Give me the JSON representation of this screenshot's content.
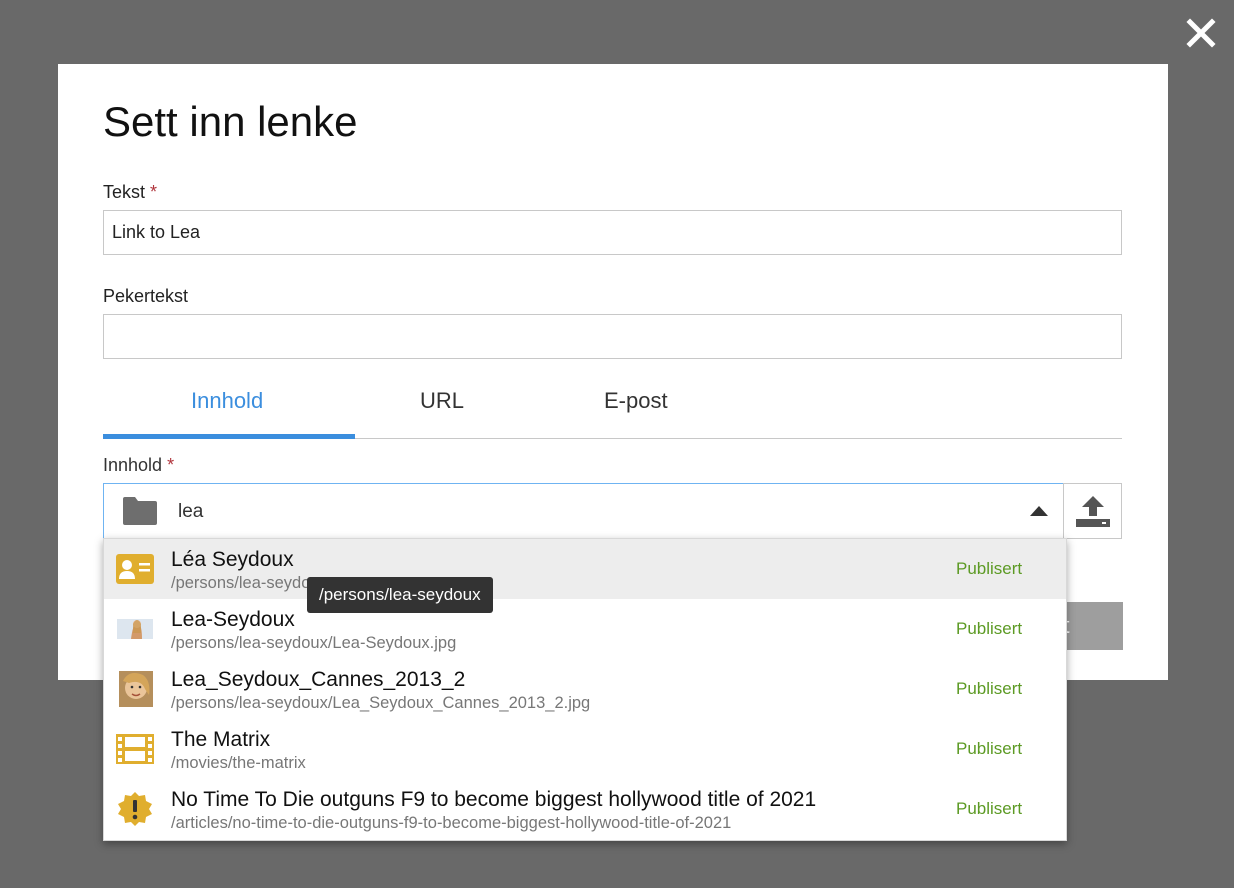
{
  "dialog": {
    "title": "Sett inn lenke",
    "close_icon": "close-icon"
  },
  "fields": {
    "text": {
      "label": "Tekst",
      "required_mark": "*",
      "value": "Link to Lea"
    },
    "tooltip_text": {
      "label": "Pekertekst",
      "value": ""
    }
  },
  "tabs": [
    {
      "label": "Innhold",
      "active": true
    },
    {
      "label": "URL",
      "active": false
    },
    {
      "label": "E-post",
      "active": false
    }
  ],
  "content_selector": {
    "label": "Innhold",
    "required_mark": "*",
    "query": "lea",
    "folder_icon": "folder-icon",
    "toggle_icon": "caret-up-icon",
    "upload_icon": "upload-icon"
  },
  "dropdown": {
    "options": [
      {
        "name": "Léa Seydoux",
        "path": "/persons/lea-seydoux",
        "status": "Publisert",
        "icon": "person-card-icon",
        "highlighted": true
      },
      {
        "name": "Lea-Seydoux",
        "path": "/persons/lea-seydoux/Lea-Seydoux.jpg",
        "status": "Publisert",
        "icon": "image-thumbnail-icon",
        "highlighted": false
      },
      {
        "name": "Lea_Seydoux_Cannes_2013_2",
        "path": "/persons/lea-seydoux/Lea_Seydoux_Cannes_2013_2.jpg",
        "status": "Publisert",
        "icon": "portrait-thumbnail-icon",
        "highlighted": false
      },
      {
        "name": "The Matrix",
        "path": "/movies/the-matrix",
        "status": "Publisert",
        "icon": "film-icon",
        "highlighted": false
      },
      {
        "name": "No Time To Die outguns F9 to become biggest hollywood title of 2021",
        "path": "/articles/no-time-to-die-outguns-f9-to-become-biggest-hollywood-title-of-2021",
        "status": "Publisert",
        "icon": "alert-badge-icon",
        "highlighted": false
      }
    ],
    "hover_tooltip": "/persons/lea-seydoux"
  },
  "footer": {
    "partially_visible_button_label": "ryt"
  },
  "colors": {
    "overlay": "#696969",
    "accent": "#3b8ede",
    "published": "#5c9a24",
    "required": "#b0343c",
    "icon_gold": "#e0ae2e"
  }
}
